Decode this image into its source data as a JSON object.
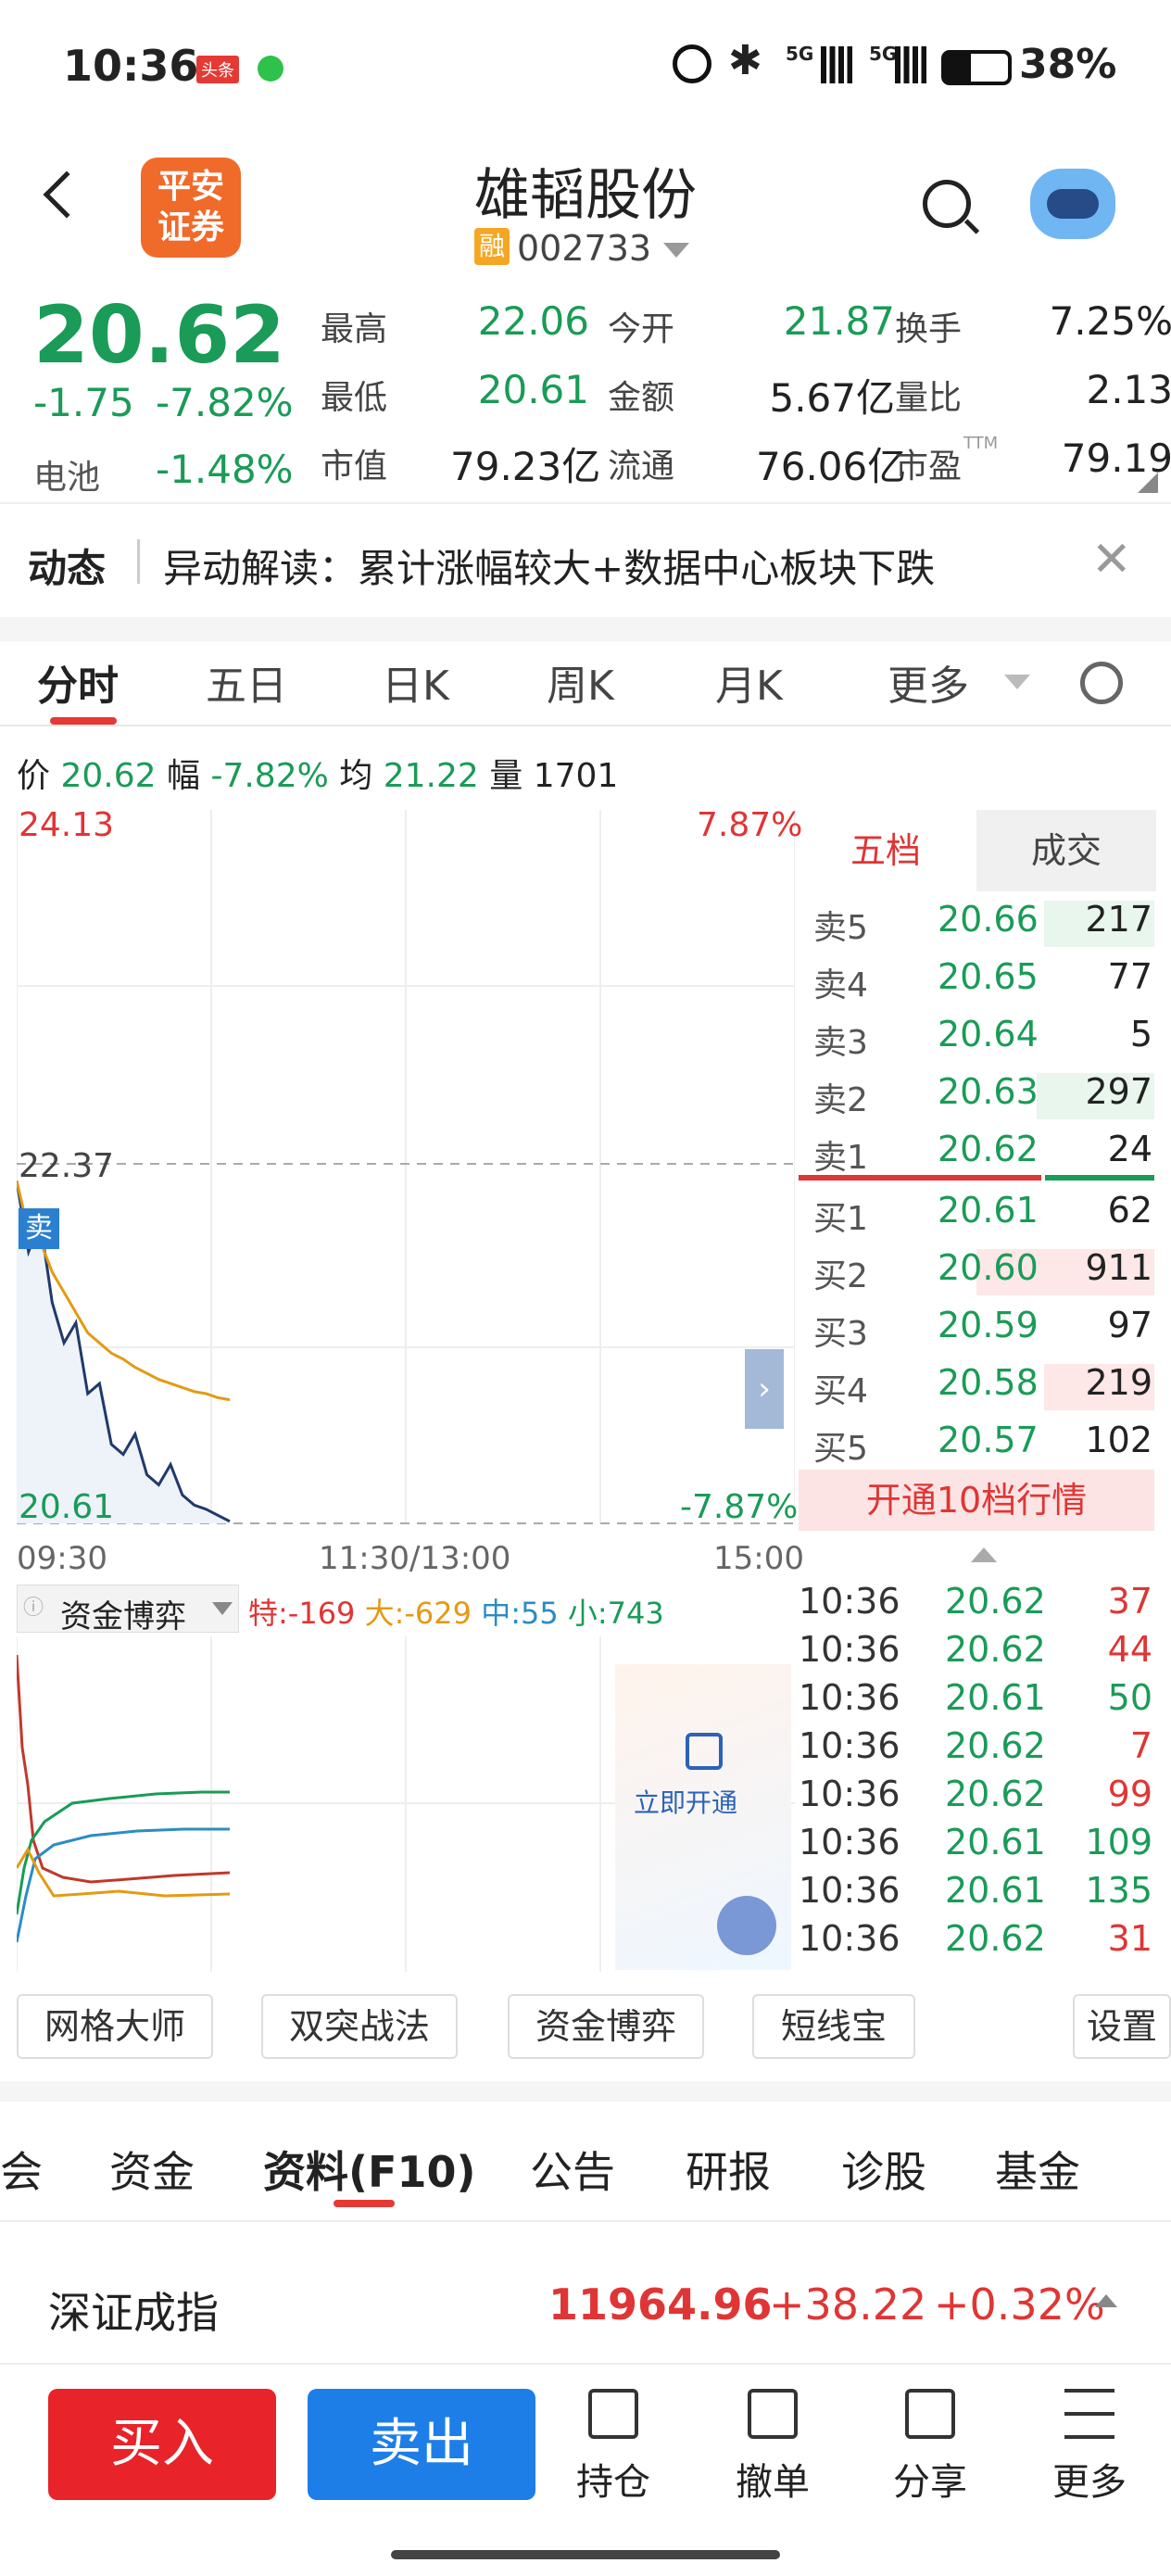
{
  "status": {
    "time": "10:36",
    "badge": "头条",
    "battery": "38%",
    "net1": "5G",
    "net2": "5G"
  },
  "header": {
    "logo": "平安证券",
    "logo_line1": "平安",
    "logo_line2": "证券",
    "title": "雄韬股份",
    "rong": "融",
    "code": "002733"
  },
  "quote": {
    "price": "20.62",
    "change": "-1.75",
    "pct": "-7.82%",
    "sector_label": "电池",
    "sector_pct": "-1.48%",
    "items": [
      {
        "label": "最高",
        "value": "22.06",
        "color": "g"
      },
      {
        "label": "今开",
        "value": "21.87",
        "color": "g"
      },
      {
        "label": "换手",
        "value": "7.25%",
        "color": "k"
      },
      {
        "label": "最低",
        "value": "20.61",
        "color": "g"
      },
      {
        "label": "金额",
        "value": "5.67亿",
        "color": "k"
      },
      {
        "label": "量比",
        "value": "2.13",
        "color": "k"
      },
      {
        "label": "市值",
        "value": "79.23亿",
        "color": "k"
      },
      {
        "label": "流通",
        "value": "76.06亿",
        "color": "k"
      },
      {
        "label": "市盈",
        "value": "79.19",
        "color": "k"
      }
    ],
    "ttm": "TTM"
  },
  "news": {
    "tag": "动态",
    "text": "异动解读：累计涨幅较大+数据中心板块下跌"
  },
  "tabs": [
    "分时",
    "五日",
    "日K",
    "周K",
    "月K",
    "更多"
  ],
  "infobar": {
    "l1": "价",
    "v1": "20.62",
    "l2": "幅",
    "v2": "-7.82%",
    "l3": "均",
    "v3": "21.22",
    "l4": "量",
    "v4": "1701"
  },
  "chart": {
    "top_price": "24.13",
    "top_pct": "7.87%",
    "mid_price": "22.37",
    "bot_price": "20.61",
    "bot_pct": "-7.87%",
    "sell_tag": "卖",
    "t1": "09:30",
    "t2": "11:30/13:00",
    "t3": "15:00"
  },
  "chart_data": {
    "type": "line",
    "title": "",
    "xlabel": "",
    "ylabel": "",
    "ylim": [
      20.61,
      24.13
    ],
    "series": [
      {
        "values": [
          22.3,
          21.95,
          22.1,
          21.7,
          21.5,
          21.6,
          21.25,
          21.3,
          21.0,
          20.95,
          21.05,
          20.85,
          20.8,
          20.9,
          20.75,
          20.7,
          20.68,
          20.65,
          20.62
        ]
      },
      {
        "values": [
          22.3,
          22.05,
          22.0,
          21.85,
          21.75,
          21.65,
          21.55,
          21.5,
          21.45,
          21.42,
          21.38,
          21.35,
          21.32,
          21.3,
          21.28,
          21.26,
          21.25,
          21.23,
          21.22
        ]
      }
    ]
  },
  "capital": {
    "title": "资金博弈",
    "te": "特:-169",
    "da": "大:-629",
    "zhong": "中:55",
    "xiao": "小:743",
    "lock": "立即开通"
  },
  "book": {
    "tab1": "五档",
    "tab2": "成交",
    "sells": [
      {
        "l": "卖5",
        "p": "20.66",
        "v": "217"
      },
      {
        "l": "卖4",
        "p": "20.65",
        "v": "77"
      },
      {
        "l": "卖3",
        "p": "20.64",
        "v": "5"
      },
      {
        "l": "卖2",
        "p": "20.63",
        "v": "297"
      },
      {
        "l": "卖1",
        "p": "20.62",
        "v": "24"
      }
    ],
    "buys": [
      {
        "l": "买1",
        "p": "20.61",
        "v": "62"
      },
      {
        "l": "买2",
        "p": "20.60",
        "v": "911"
      },
      {
        "l": "买3",
        "p": "20.59",
        "v": "97"
      },
      {
        "l": "买4",
        "p": "20.58",
        "v": "219"
      },
      {
        "l": "买5",
        "p": "20.57",
        "v": "102"
      }
    ],
    "open10": "开通10档行情",
    "ticks": [
      {
        "t": "10:36",
        "p": "20.62",
        "v": "37"
      },
      {
        "t": "10:36",
        "p": "20.62",
        "v": "44"
      },
      {
        "t": "10:36",
        "p": "20.61",
        "v": "50"
      },
      {
        "t": "10:36",
        "p": "20.62",
        "v": "7"
      },
      {
        "t": "10:36",
        "p": "20.62",
        "v": "99"
      },
      {
        "t": "10:36",
        "p": "20.61",
        "v": "109"
      },
      {
        "t": "10:36",
        "p": "20.61",
        "v": "135"
      },
      {
        "t": "10:36",
        "p": "20.62",
        "v": "31"
      }
    ]
  },
  "tools": [
    "网格大师",
    "双突战法",
    "资金博弈",
    "短线宝",
    "设置"
  ],
  "ftabs": [
    "会",
    "资金",
    "资料(F10)",
    "公告",
    "研报",
    "诊股",
    "基金"
  ],
  "index": {
    "name": "深证成指",
    "value": "11964.96",
    "change": "+38.22",
    "pct": "+0.32%"
  },
  "bottom": {
    "buy": "买入",
    "sell": "卖出",
    "hold": "持仓",
    "cancel": "撤单",
    "share": "分享",
    "more": "更多"
  }
}
